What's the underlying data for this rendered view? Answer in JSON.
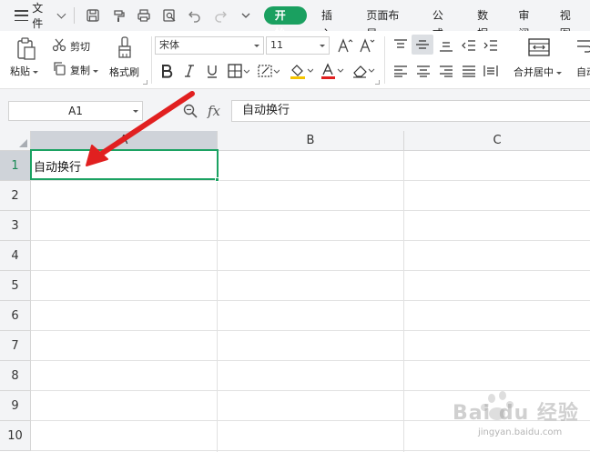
{
  "menubar": {
    "file_label": "文件",
    "tabs": [
      {
        "label": "开始",
        "active": true
      },
      {
        "label": "插入",
        "active": false
      },
      {
        "label": "页面布局",
        "active": false
      },
      {
        "label": "公式",
        "active": false
      },
      {
        "label": "数据",
        "active": false
      },
      {
        "label": "审阅",
        "active": false
      },
      {
        "label": "视图",
        "active": false
      }
    ],
    "quick_access": [
      "save-icon",
      "format-painter-icon",
      "print-icon",
      "print-preview-icon",
      "undo-icon",
      "redo-icon",
      "more-icon"
    ]
  },
  "ribbon": {
    "paste_label": "粘贴",
    "cut_label": "剪切",
    "copy_label": "复制",
    "format_painter_label": "格式刷",
    "font_name": "宋体",
    "font_size": "11",
    "merge_center_label": "合并居中",
    "wrap_label": "自动"
  },
  "formula_bar": {
    "name_box": "A1",
    "fx_symbol": "fx",
    "content": "自动换行"
  },
  "sheet": {
    "columns": [
      "A",
      "B",
      "C"
    ],
    "rows": [
      "1",
      "2",
      "3",
      "4",
      "5",
      "6",
      "7",
      "8",
      "9",
      "10"
    ],
    "selected_cell": "A1",
    "cells": {
      "A1": "自动换行"
    }
  },
  "watermark": {
    "brand": "Bai du 经验",
    "url": "jingyan.baidu.com"
  },
  "colors": {
    "accent_green": "#1aa060",
    "annotation_red": "#e12020"
  }
}
